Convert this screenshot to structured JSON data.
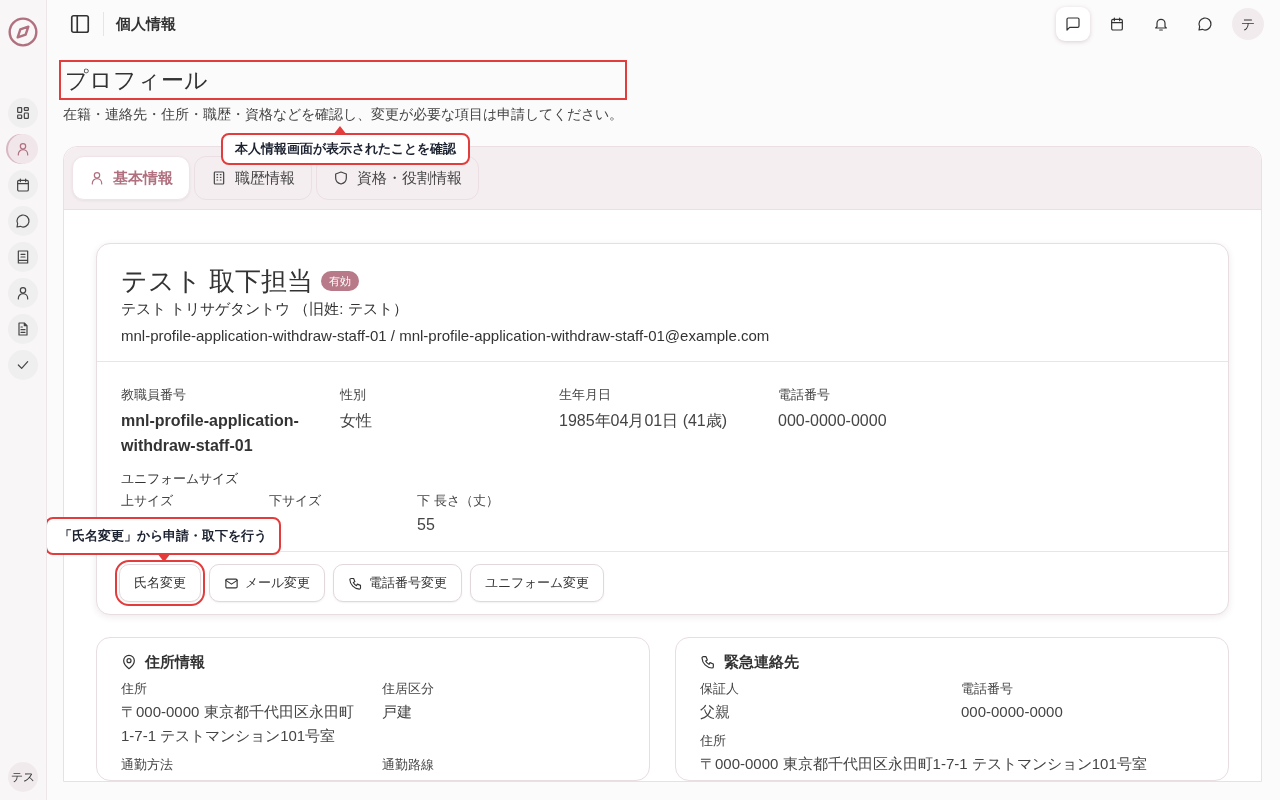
{
  "header": {
    "title": "個人情報",
    "actions": [
      {
        "kind": "chat-square",
        "selected": true
      },
      {
        "kind": "calendar",
        "selected": false
      },
      {
        "kind": "bell",
        "selected": false
      },
      {
        "kind": "chat",
        "selected": false
      }
    ],
    "avatar": "テ"
  },
  "sidebar": {
    "items": [
      {
        "kind": "grid",
        "selected": false
      },
      {
        "kind": "person",
        "selected": true
      },
      {
        "kind": "calendar",
        "selected": false
      },
      {
        "kind": "chat",
        "selected": false
      },
      {
        "kind": "book",
        "selected": false
      },
      {
        "kind": "person",
        "selected": false
      },
      {
        "kind": "document",
        "selected": false
      },
      {
        "kind": "check",
        "selected": false
      }
    ],
    "user": "テス"
  },
  "page": {
    "title": "プロフィール",
    "highlighted": true,
    "subtitle": "在籍・連絡先・住所・職歴・資格などを確認し、変更が必要な項目は申請してください。"
  },
  "tabs": [
    {
      "kind": "person",
      "label": "基本情報",
      "selected": true
    },
    {
      "kind": "building",
      "label": "職歴情報",
      "selected": false
    },
    {
      "kind": "shield",
      "label": "資格・役割情報",
      "selected": false
    }
  ],
  "profile": {
    "name": "テスト 取下担当",
    "status": "有効",
    "kana": "テスト トリサゲタントウ （旧姓: テスト）",
    "account": "mnl-profile-application-withdraw-staff-01 / mnl-profile-application-withdraw-staff-01@example.com",
    "fields": [
      {
        "label": "教職員番号",
        "value": "mnl-profile-application-withdraw-staff-01",
        "bold": true
      },
      {
        "label": "性別",
        "value": "女性",
        "bold": false
      },
      {
        "label": "生年月日",
        "value": "1985年04月01日 (41歳)",
        "bold": false
      },
      {
        "label": "電話番号",
        "value": "000-0000-0000",
        "bold": false
      }
    ],
    "uniform": {
      "title": "ユニフォームサイズ",
      "fields": [
        {
          "label": "上サイズ"
        },
        {
          "label": "下サイズ"
        },
        {
          "label": "下 長さ（丈）",
          "value": "55"
        }
      ]
    },
    "actions": [
      {
        "kind": "none",
        "label": "氏名変更",
        "highlighted": true
      },
      {
        "kind": "mail",
        "label": "メール変更",
        "highlighted": false
      },
      {
        "kind": "phone",
        "label": "電話番号変更",
        "highlighted": false
      },
      {
        "kind": "none",
        "label": "ユニフォーム変更",
        "highlighted": false
      }
    ]
  },
  "cards": [
    {
      "kind": "pin",
      "title": "住所情報",
      "fields": [
        {
          "label": "住所",
          "value": "〒000-0000 東京都千代田区永田町1-7-1 テストマンション101号室",
          "wide": false
        },
        {
          "label": "住居区分",
          "value": "戸建",
          "wide": false
        },
        {
          "label": "通勤方法",
          "wide": false
        },
        {
          "label": "通勤路線",
          "wide": false
        }
      ]
    },
    {
      "kind": "phone",
      "title": "緊急連絡先",
      "fields": [
        {
          "label": "保証人",
          "value": "父親",
          "wide": false
        },
        {
          "label": "電話番号",
          "value": "000-0000-0000",
          "wide": false
        },
        {
          "label": "住所",
          "value": "〒000-0000 東京都千代田区永田町1-7-1 テストマンション101号室",
          "wide": true
        }
      ]
    }
  ],
  "callouts": [
    {
      "text": "本人情報画面が表示されたことを確認"
    },
    {
      "text": "「氏名変更」から申請・取下を行う"
    }
  ]
}
